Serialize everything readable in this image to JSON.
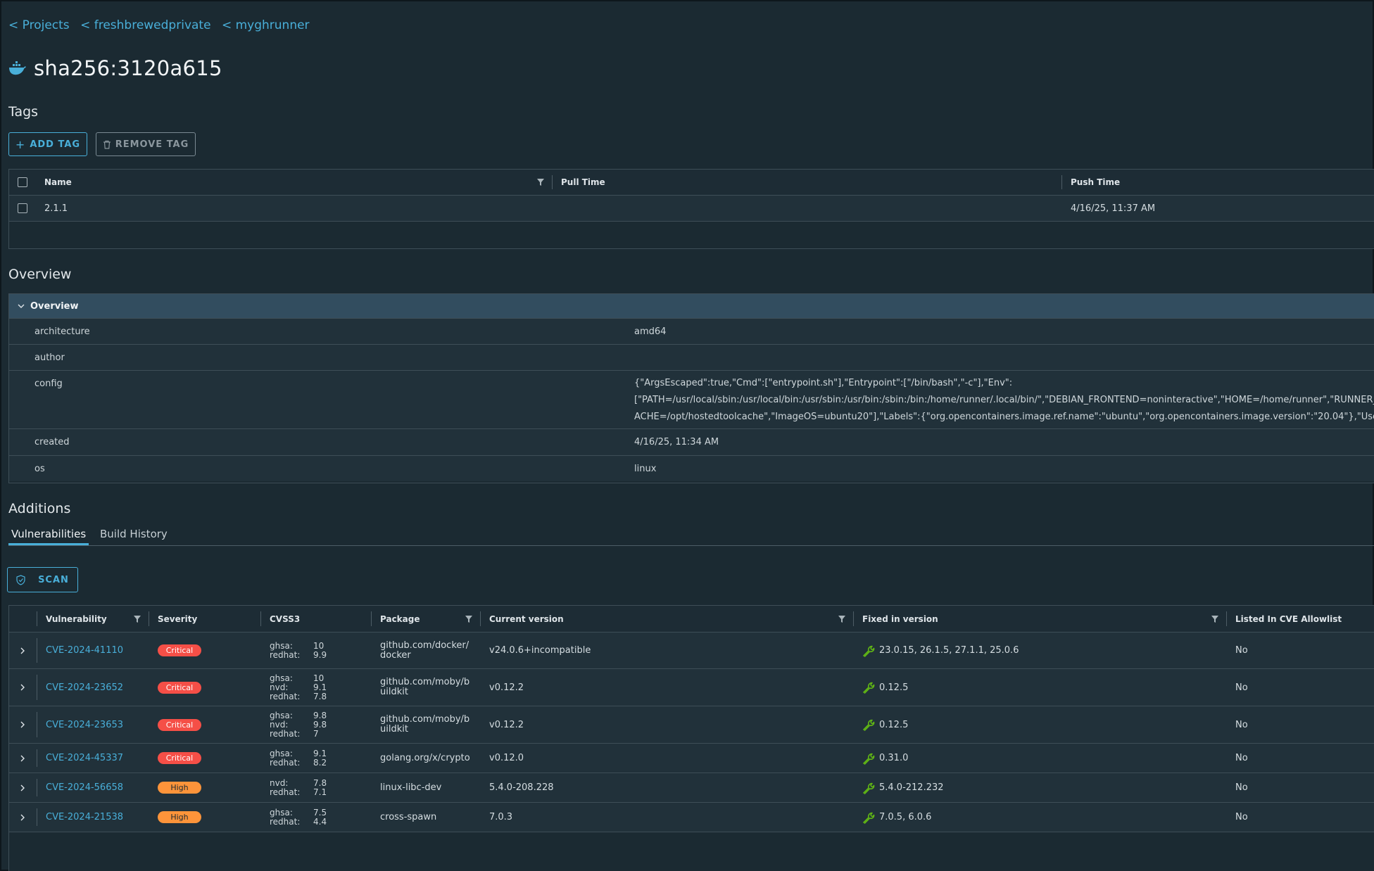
{
  "breadcrumbs": [
    "< Projects",
    "< freshbrewedprivate",
    "< myghrunner"
  ],
  "artifact": {
    "title": "sha256:3120a615",
    "icon": "docker-whale-icon"
  },
  "tags_section": {
    "heading": "Tags",
    "add_label": "ADD TAG",
    "remove_label": "REMOVE TAG",
    "columns": [
      "Name",
      "Pull Time",
      "Push Time"
    ],
    "rows": [
      {
        "name": "2.1.1",
        "pull_time": "",
        "push_time": "4/16/25, 11:37 AM"
      }
    ]
  },
  "overview_section": {
    "heading": "Overview",
    "panel_title": "Overview",
    "rows": [
      {
        "key": "architecture",
        "value": "amd64"
      },
      {
        "key": "author",
        "value": ""
      },
      {
        "key": "config",
        "lines": [
          "{\"ArgsEscaped\":true,\"Cmd\":[\"entrypoint.sh\"],\"Entrypoint\":[\"/bin/bash\",\"-c\"],\"Env\":",
          "[\"PATH=/usr/local/sbin:/usr/local/bin:/usr/sbin:/usr/bin:/sbin:/bin:/home/runner/.local/bin/\",\"DEBIAN_FRONTEND=noninteractive\",\"HOME=/home/runner\",\"RUNNER_TOOL_C",
          "ACHE=/opt/hostedtoolcache\",\"ImageOS=ubuntu20\"],\"Labels\":{\"org.opencontainers.image.ref.name\":\"ubuntu\",\"org.opencontainers.image.version\":\"20.04\"},\"User\":\"runner\"}"
        ]
      },
      {
        "key": "created",
        "value": "4/16/25, 11:34 AM"
      },
      {
        "key": "os",
        "value": "linux"
      }
    ]
  },
  "additions": {
    "heading": "Additions",
    "tabs": [
      "Vulnerabilities",
      "Build History"
    ],
    "active_tab": "Vulnerabilities",
    "scan_label": "SCAN",
    "columns": [
      "Vulnerability",
      "Severity",
      "CVSS3",
      "Package",
      "Current version",
      "Fixed in version",
      "Listed In CVE Allowlist"
    ],
    "rows": [
      {
        "cve": "CVE-2024-41110",
        "severity": "Critical",
        "cvss": [
          [
            "ghsa:",
            "10"
          ],
          [
            "redhat:",
            "9.9"
          ]
        ],
        "package": [
          "github.com/docker/",
          "docker"
        ],
        "current": "v24.0.6+incompatible",
        "fixed": "23.0.15, 26.1.5, 27.1.1, 25.0.6",
        "allow": "No"
      },
      {
        "cve": "CVE-2024-23652",
        "severity": "Critical",
        "cvss": [
          [
            "ghsa:",
            "10"
          ],
          [
            "nvd:",
            "9.1"
          ],
          [
            "redhat:",
            "7.8"
          ]
        ],
        "package": [
          "github.com/moby/b",
          "uildkit"
        ],
        "current": "v0.12.2",
        "fixed": "0.12.5",
        "allow": "No"
      },
      {
        "cve": "CVE-2024-23653",
        "severity": "Critical",
        "cvss": [
          [
            "ghsa:",
            "9.8"
          ],
          [
            "nvd:",
            "9.8"
          ],
          [
            "redhat:",
            "7"
          ]
        ],
        "package": [
          "github.com/moby/b",
          "uildkit"
        ],
        "current": "v0.12.2",
        "fixed": "0.12.5",
        "allow": "No"
      },
      {
        "cve": "CVE-2024-45337",
        "severity": "Critical",
        "cvss": [
          [
            "ghsa:",
            "9.1"
          ],
          [
            "redhat:",
            "8.2"
          ]
        ],
        "package": [
          "golang.org/x/crypto"
        ],
        "current": "v0.12.0",
        "fixed": "0.31.0",
        "allow": "No"
      },
      {
        "cve": "CVE-2024-56658",
        "severity": "High",
        "cvss": [
          [
            "nvd:",
            "7.8"
          ],
          [
            "redhat:",
            "7.1"
          ]
        ],
        "package": [
          "linux-libc-dev"
        ],
        "current": "5.4.0-208.228",
        "fixed": "5.4.0-212.232",
        "allow": "No"
      },
      {
        "cve": "CVE-2024-21538",
        "severity": "High",
        "cvss": [
          [
            "ghsa:",
            "7.5"
          ],
          [
            "redhat:",
            "4.4"
          ]
        ],
        "package": [
          "cross-spawn"
        ],
        "current": "7.0.3",
        "fixed": "7.0.5, 6.0.6",
        "allow": "No"
      }
    ]
  },
  "colors": {
    "accent": "#49afd9",
    "background": "#1b2a32",
    "critical": "#f54f47",
    "high": "#fd943a",
    "fix_icon": "#60b515"
  }
}
